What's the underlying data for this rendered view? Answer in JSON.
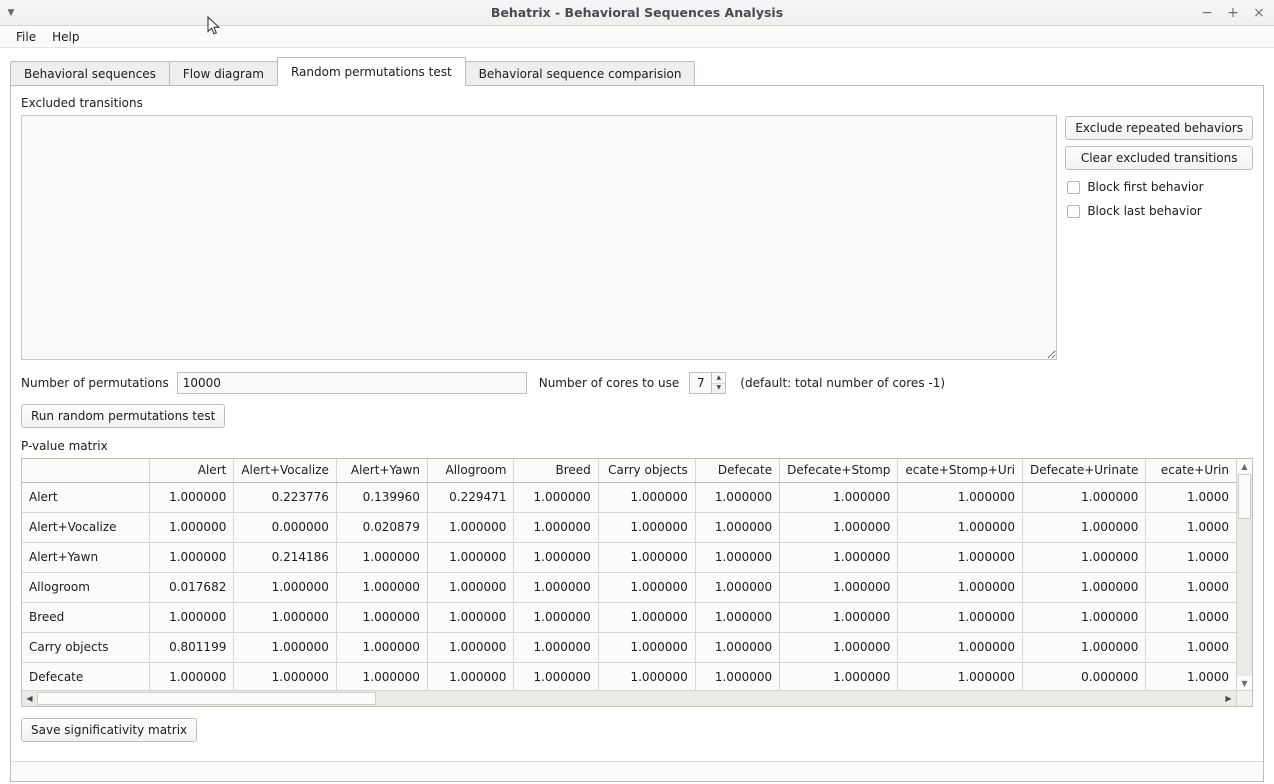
{
  "window": {
    "title": "Behatrix - Behavioral Sequences Analysis",
    "menu_arrow_icon": "chevron-down-icon",
    "controls": [
      {
        "name": "minimize-button",
        "glyph": "−"
      },
      {
        "name": "maximize-button",
        "glyph": "+"
      },
      {
        "name": "close-button",
        "glyph": "×"
      }
    ]
  },
  "menubar": {
    "items": [
      {
        "label": "File"
      },
      {
        "label": "Help"
      }
    ]
  },
  "tabs": [
    {
      "label": "Behavioral sequences",
      "active": false
    },
    {
      "label": "Flow diagram",
      "active": false
    },
    {
      "label": "Random permutations test",
      "active": true
    },
    {
      "label": "Behavioral sequence comparision",
      "active": false
    }
  ],
  "excluded": {
    "label": "Excluded transitions",
    "textarea_value": "",
    "buttons": [
      {
        "label": "Exclude repeated behaviors",
        "name": "exclude-repeated-behaviors-button"
      },
      {
        "label": "Clear excluded transitions",
        "name": "clear-excluded-transitions-button"
      }
    ],
    "checkboxes": [
      {
        "label": "Block first behavior",
        "checked": false,
        "name": "block-first-behavior-checkbox"
      },
      {
        "label": "Block last behavior",
        "checked": false,
        "name": "block-last-behavior-checkbox"
      }
    ]
  },
  "permutations": {
    "num_label": "Number of permutations",
    "num_value": "10000",
    "cores_label": "Number of cores to use",
    "cores_value": "7",
    "hint": "(default: total number of cores -1)",
    "run_button": "Run random permutations test"
  },
  "pvalue": {
    "label": "P-value matrix",
    "save_button": "Save significativity matrix",
    "columns": [
      "Alert",
      "Alert+Vocalize",
      "Alert+Yawn",
      "Allogroom",
      "Breed",
      "Carry objects",
      "Defecate",
      "Defecate+Stomp",
      "ecate+Stomp+Uri",
      "Defecate+Urinate",
      "ecate+Urin"
    ],
    "rows": [
      {
        "label": "Alert",
        "values": [
          "1.000000",
          "0.223776",
          "0.139960",
          "0.229471",
          "1.000000",
          "1.000000",
          "1.000000",
          "1.000000",
          "1.000000",
          "1.000000",
          "1.0000"
        ]
      },
      {
        "label": "Alert+Vocalize",
        "values": [
          "1.000000",
          "0.000000",
          "0.020879",
          "1.000000",
          "1.000000",
          "1.000000",
          "1.000000",
          "1.000000",
          "1.000000",
          "1.000000",
          "1.0000"
        ]
      },
      {
        "label": "Alert+Yawn",
        "values": [
          "1.000000",
          "0.214186",
          "1.000000",
          "1.000000",
          "1.000000",
          "1.000000",
          "1.000000",
          "1.000000",
          "1.000000",
          "1.000000",
          "1.0000"
        ]
      },
      {
        "label": "Allogroom",
        "values": [
          "0.017682",
          "1.000000",
          "1.000000",
          "1.000000",
          "1.000000",
          "1.000000",
          "1.000000",
          "1.000000",
          "1.000000",
          "1.000000",
          "1.0000"
        ]
      },
      {
        "label": "Breed",
        "values": [
          "1.000000",
          "1.000000",
          "1.000000",
          "1.000000",
          "1.000000",
          "1.000000",
          "1.000000",
          "1.000000",
          "1.000000",
          "1.000000",
          "1.0000"
        ]
      },
      {
        "label": "Carry objects",
        "values": [
          "0.801199",
          "1.000000",
          "1.000000",
          "1.000000",
          "1.000000",
          "1.000000",
          "1.000000",
          "1.000000",
          "1.000000",
          "1.000000",
          "1.0000"
        ]
      },
      {
        "label": "Defecate",
        "values": [
          "1.000000",
          "1.000000",
          "1.000000",
          "1.000000",
          "1.000000",
          "1.000000",
          "1.000000",
          "1.000000",
          "1.000000",
          "0.000000",
          "1.0000"
        ]
      }
    ],
    "scroll": {
      "v_up_icon": "triangle-up-icon",
      "v_down_icon": "triangle-down-icon",
      "h_left_icon": "triangle-left-icon",
      "h_right_icon": "triangle-right-icon"
    }
  },
  "colors": {
    "window_bg": "#ffffff",
    "titlebar_bg": "#f2f1ef",
    "panel_border": "#bfbdba",
    "field_bg": "#fafaf9",
    "title_text": "#4a4a52"
  }
}
